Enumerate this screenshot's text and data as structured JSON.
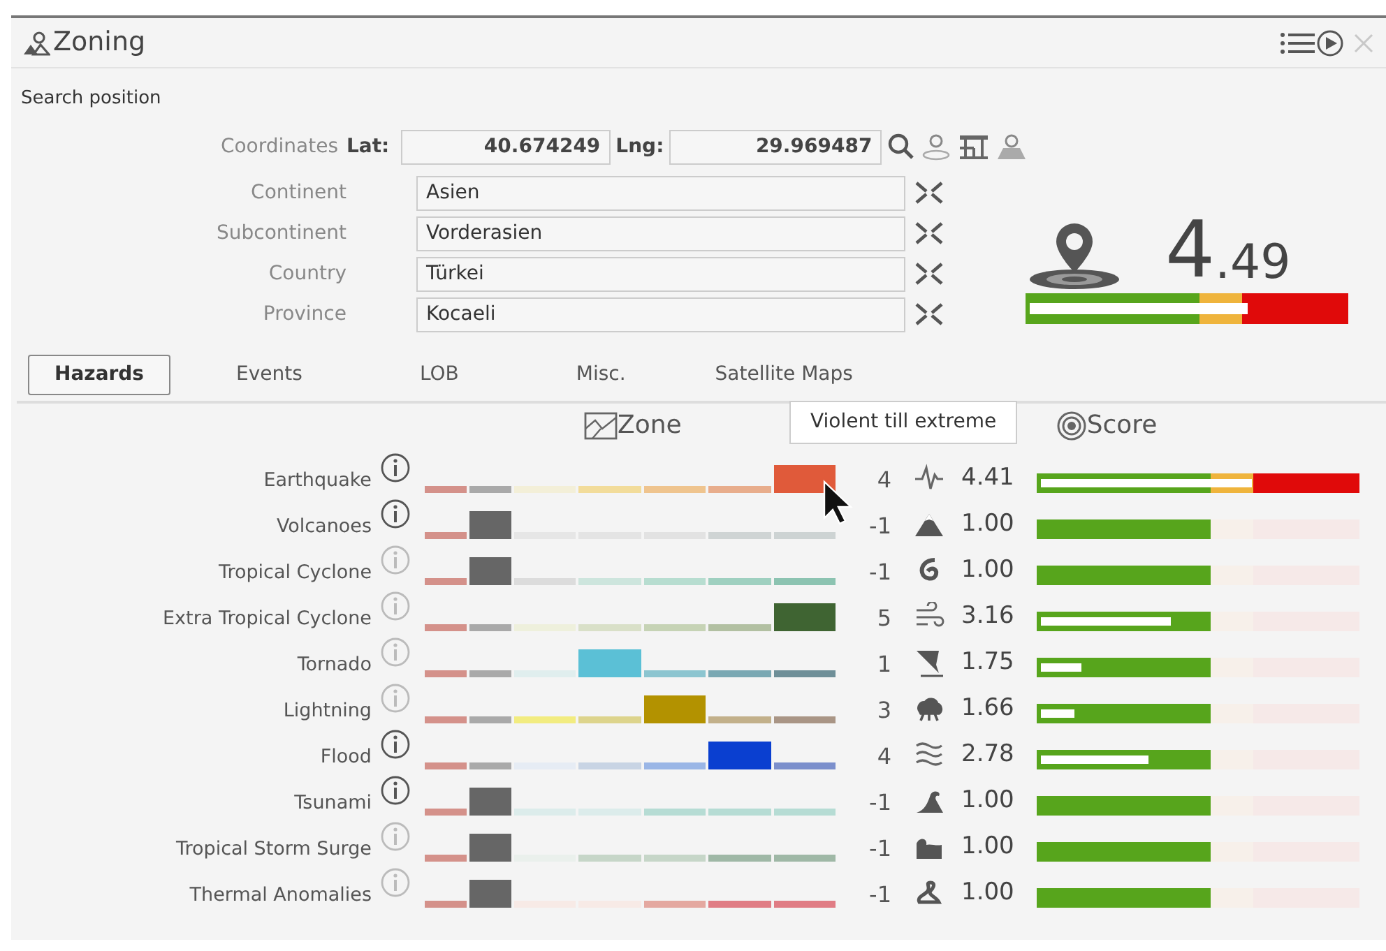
{
  "window": {
    "title": "Zoning"
  },
  "search": {
    "heading": "Search position",
    "coordinates_label": "Coordinates",
    "lat_label": "Lat:",
    "lat": "40.674249",
    "lng_label": "Lng:",
    "lng": "29.969487"
  },
  "location_fields": [
    {
      "label": "Continent",
      "value": "Asien"
    },
    {
      "label": "Subcontinent",
      "value": "Vorderasien"
    },
    {
      "label": "Country",
      "value": "Türkei"
    },
    {
      "label": "Province",
      "value": "Kocaeli"
    }
  ],
  "total_score": {
    "integer": "4",
    "decimals": ".49",
    "level": 0.7
  },
  "tabs": [
    {
      "label": "Hazards",
      "selected": true
    },
    {
      "label": "Events",
      "selected": false
    },
    {
      "label": "LOB",
      "selected": false
    },
    {
      "label": "Misc.",
      "selected": false
    },
    {
      "label": "Satellite Maps",
      "selected": false
    }
  ],
  "columns": {
    "zone": "Zone",
    "score": "Score"
  },
  "tooltip": "Violent till extreme",
  "hazards": [
    {
      "name": "Earthquake",
      "info_available": true,
      "active": true,
      "zone": "4",
      "score": "4.41",
      "level": 0.68,
      "segments": [
        {
          "color": "#d4918a",
          "selected": false
        },
        {
          "color": "#a9a9a9",
          "selected": false
        },
        {
          "color": "#f3efd8",
          "selected": false
        },
        {
          "color": "#f2dc9a",
          "selected": false
        },
        {
          "color": "#efc48e",
          "selected": false
        },
        {
          "color": "#e8ad8c",
          "selected": false
        },
        {
          "color": "#e05a3a",
          "selected": true
        }
      ]
    },
    {
      "name": "Volcanoes",
      "info_available": true,
      "active": false,
      "zone": "-1",
      "score": "1.00",
      "segments": [
        {
          "color": "#d4918a",
          "selected": false
        },
        {
          "color": "#666666",
          "selected": true
        },
        {
          "color": "#e6e6e6",
          "selected": false
        },
        {
          "color": "#e4e4e4",
          "selected": false
        },
        {
          "color": "#e2e2e2",
          "selected": false
        },
        {
          "color": "#cfd4d4",
          "selected": false
        },
        {
          "color": "#cdd3d3",
          "selected": false
        }
      ]
    },
    {
      "name": "Tropical Cyclone",
      "info_available": false,
      "active": false,
      "zone": "-1",
      "score": "1.00",
      "segments": [
        {
          "color": "#d4918a",
          "selected": false
        },
        {
          "color": "#666666",
          "selected": true
        },
        {
          "color": "#dcdcdc",
          "selected": false
        },
        {
          "color": "#cde5dd",
          "selected": false
        },
        {
          "color": "#b7ddd0",
          "selected": false
        },
        {
          "color": "#9fd0c0",
          "selected": false
        },
        {
          "color": "#8cc3b1",
          "selected": false
        }
      ]
    },
    {
      "name": "Extra Tropical Cyclone",
      "info_available": false,
      "active": false,
      "zone": "5",
      "score": "3.16",
      "level": 0.43,
      "segments": [
        {
          "color": "#d4918a",
          "selected": false
        },
        {
          "color": "#a9a9a9",
          "selected": false
        },
        {
          "color": "#eef0dc",
          "selected": false
        },
        {
          "color": "#d9e0c8",
          "selected": false
        },
        {
          "color": "#c6d3b5",
          "selected": false
        },
        {
          "color": "#b2c0a2",
          "selected": false
        },
        {
          "color": "#3f6432",
          "selected": true
        }
      ]
    },
    {
      "name": "Tornado",
      "info_available": false,
      "active": false,
      "zone": "1",
      "score": "1.75",
      "level": 0.15,
      "segments": [
        {
          "color": "#d4918a",
          "selected": false
        },
        {
          "color": "#a9a9a9",
          "selected": false
        },
        {
          "color": "#e0eeee",
          "selected": false
        },
        {
          "color": "#5bc0d6",
          "selected": true
        },
        {
          "color": "#8cc5d0",
          "selected": false
        },
        {
          "color": "#7aa8b3",
          "selected": false
        },
        {
          "color": "#6f8f98",
          "selected": false
        }
      ]
    },
    {
      "name": "Lightning",
      "info_available": false,
      "active": false,
      "zone": "3",
      "score": "1.66",
      "level": 0.13,
      "segments": [
        {
          "color": "#d4918a",
          "selected": false
        },
        {
          "color": "#a9a9a9",
          "selected": false
        },
        {
          "color": "#f2ec80",
          "selected": false
        },
        {
          "color": "#ddd48c",
          "selected": false
        },
        {
          "color": "#b39200",
          "selected": true
        },
        {
          "color": "#c2b08a",
          "selected": false
        },
        {
          "color": "#a99585",
          "selected": false
        }
      ]
    },
    {
      "name": "Flood",
      "info_available": true,
      "active": false,
      "zone": "4",
      "score": "2.78",
      "level": 0.36,
      "segments": [
        {
          "color": "#d4918a",
          "selected": false
        },
        {
          "color": "#a9a9a9",
          "selected": false
        },
        {
          "color": "#e6ecf4",
          "selected": false
        },
        {
          "color": "#c8d4e4",
          "selected": false
        },
        {
          "color": "#9ab6e6",
          "selected": false
        },
        {
          "color": "#0a3fd0",
          "selected": true
        },
        {
          "color": "#7b8fcc",
          "selected": false
        }
      ]
    },
    {
      "name": "Tsunami",
      "info_available": true,
      "active": false,
      "zone": "-1",
      "score": "1.00",
      "segments": [
        {
          "color": "#d4918a",
          "selected": false
        },
        {
          "color": "#666666",
          "selected": true
        },
        {
          "color": "#dceceb",
          "selected": false
        },
        {
          "color": "#dceceb",
          "selected": false
        },
        {
          "color": "#b6dcd4",
          "selected": false
        },
        {
          "color": "#b6dcd4",
          "selected": false
        },
        {
          "color": "#b6dcd4",
          "selected": false
        }
      ]
    },
    {
      "name": "Tropical Storm Surge",
      "info_available": false,
      "active": false,
      "zone": "-1",
      "score": "1.00",
      "segments": [
        {
          "color": "#d4918a",
          "selected": false
        },
        {
          "color": "#666666",
          "selected": true
        },
        {
          "color": "#eaf0ec",
          "selected": false
        },
        {
          "color": "#c6d6c8",
          "selected": false
        },
        {
          "color": "#c6d6c8",
          "selected": false
        },
        {
          "color": "#9fb8a6",
          "selected": false
        },
        {
          "color": "#9fb8a6",
          "selected": false
        }
      ]
    },
    {
      "name": "Thermal Anomalies",
      "info_available": false,
      "active": false,
      "zone": "-1",
      "score": "1.00",
      "segments": [
        {
          "color": "#d4918a",
          "selected": false
        },
        {
          "color": "#666666",
          "selected": true
        },
        {
          "color": "#f7eae6",
          "selected": false
        },
        {
          "color": "#f7eae6",
          "selected": false
        },
        {
          "color": "#e4a8a0",
          "selected": false
        },
        {
          "color": "#e07c84",
          "selected": false
        },
        {
          "color": "#e07c84",
          "selected": false
        }
      ]
    }
  ]
}
